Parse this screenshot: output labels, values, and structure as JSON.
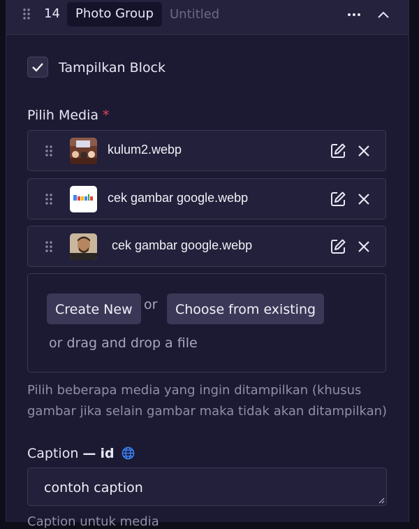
{
  "header": {
    "number": "14",
    "block_type": "Photo Group",
    "block_title": "Untitled"
  },
  "visibility": {
    "label": "Tampilkan Block",
    "checked": true
  },
  "media": {
    "label": "Pilih Media",
    "required_mark": "*",
    "items": [
      {
        "name": "kulum2.webp",
        "thumb": "classroom-photo"
      },
      {
        "name": "cek gambar google.webp",
        "thumb": "google-logo"
      },
      {
        "name": "cek gambar google.webp",
        "thumb": "person-photo"
      }
    ],
    "create_new_label": "Create New",
    "or_label": "or",
    "choose_existing_label": "Choose from existing",
    "drag_drop_label": "or drag and drop a file",
    "help_text": "Pilih beberapa media yang ingin ditampilkan (khusus gambar jika selain gambar maka tidak akan ditampilkan)"
  },
  "caption": {
    "label": "Caption",
    "dash": "—",
    "lang": "id",
    "value": "contoh caption",
    "help_text": "Caption untuk media"
  },
  "colors": {
    "panel_bg": "#1c1a32",
    "header_bg": "#24223c",
    "button_bg": "#3b3857",
    "required": "#e2455b",
    "globe": "#3b82f6"
  }
}
